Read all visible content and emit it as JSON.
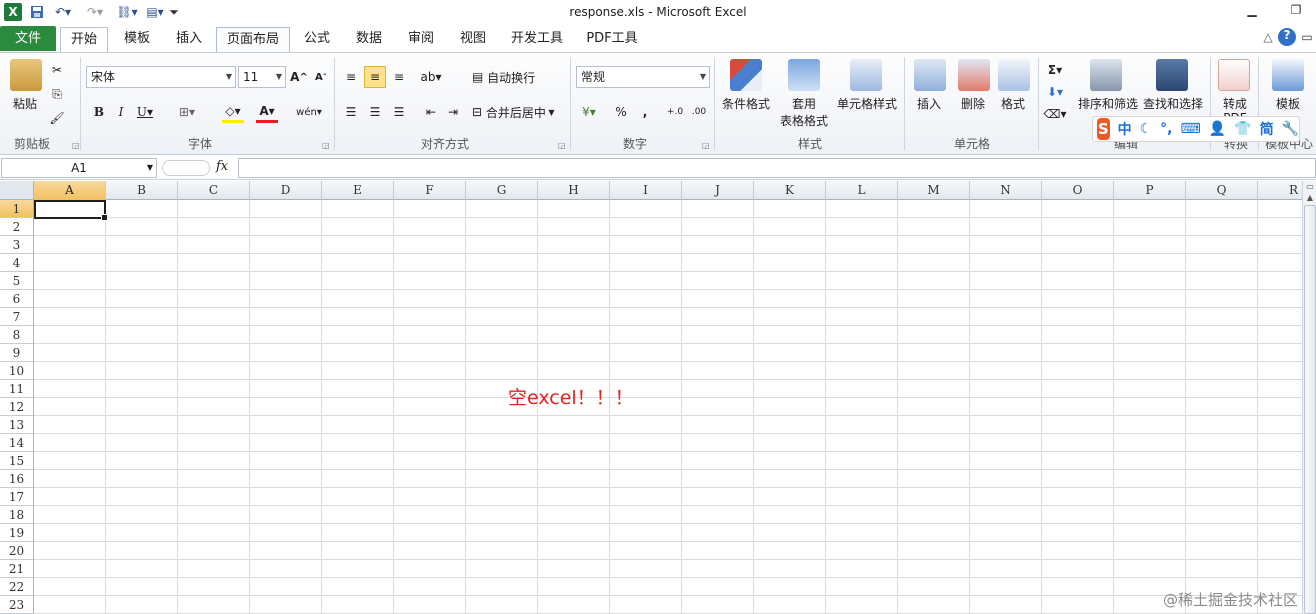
{
  "window": {
    "title": "response.xls  -  Microsoft Excel"
  },
  "quick_access": {
    "icons": [
      "excel-logo-icon",
      "save-icon",
      "undo-icon",
      "redo-icon",
      "find-icon",
      "print-preview-icon",
      "customize-icon"
    ]
  },
  "tabs": {
    "file": "文件",
    "items": [
      "开始",
      "模板",
      "插入",
      "页面布局",
      "公式",
      "数据",
      "审阅",
      "视图",
      "开发工具",
      "PDF工具"
    ]
  },
  "ribbon": {
    "clipboard": {
      "paste": "粘贴",
      "group": "剪贴板"
    },
    "font": {
      "name": "宋体",
      "size": "11",
      "group": "字体"
    },
    "alignment": {
      "wrap": "自动换行",
      "merge": "合并后居中",
      "group": "对齐方式"
    },
    "number": {
      "format": "常规",
      "percent": "%",
      "comma": ",",
      "group": "数字"
    },
    "styles": {
      "conditional": "条件格式",
      "table1": "套用",
      "table2": "表格格式",
      "cell_styles": "单元格样式",
      "group": "样式"
    },
    "cells": {
      "insert": "插入",
      "delete": "删除",
      "format": "格式",
      "group": "单元格"
    },
    "editing": {
      "sort": "排序和筛选",
      "find": "查找和选择",
      "group": "编辑"
    },
    "convert": {
      "to_pdf": "转成",
      "to_pdf2": "PDF",
      "group": "转换"
    },
    "template": {
      "label": "模板",
      "group": "模板中心"
    }
  },
  "formula_bar": {
    "name_box": "A1",
    "fx": "fx",
    "formula": ""
  },
  "sheet": {
    "columns": [
      "A",
      "B",
      "C",
      "D",
      "E",
      "F",
      "G",
      "H",
      "I",
      "J",
      "K",
      "L",
      "M",
      "N",
      "O",
      "P",
      "Q",
      "R"
    ],
    "rows": [
      "1",
      "2",
      "3",
      "4",
      "5",
      "6",
      "7",
      "8",
      "9",
      "10",
      "11",
      "12",
      "13",
      "14",
      "15",
      "16",
      "17",
      "18",
      "19",
      "20",
      "21",
      "22",
      "23"
    ],
    "active_cell": "A1",
    "overlay_text": "空excel！！！"
  },
  "ime": {
    "logo": "S",
    "mode": "中",
    "simplified": "简"
  },
  "watermark": "@稀土掘金技术社区",
  "colors": {
    "file_tab": "#2a8a3e",
    "overlay_text": "#e02424",
    "selection_header": "#f1c15f"
  }
}
